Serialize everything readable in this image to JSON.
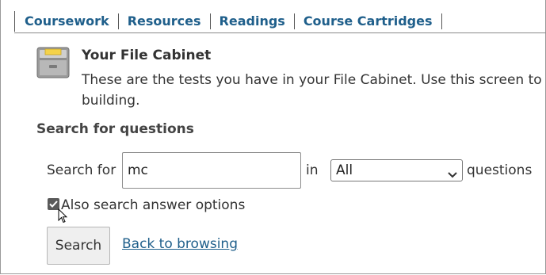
{
  "nav": {
    "items": [
      {
        "label": "Coursework"
      },
      {
        "label": "Resources"
      },
      {
        "label": "Readings"
      },
      {
        "label": "Course Cartridges"
      }
    ]
  },
  "header": {
    "title": "Your File Cabinet",
    "description": "These are the tests you have in your File Cabinet. Use this screen to",
    "description_cont": "building.",
    "icon": "file-cabinet-icon"
  },
  "search": {
    "heading": "Search for questions",
    "search_for_label": "Search for",
    "query_value": "mc",
    "in_label": "in",
    "scope_selected": "All",
    "questions_label": "questions",
    "also_answers_label": "Also search answer options",
    "also_answers_checked": true,
    "search_button": "Search",
    "back_link": "Back to browsing"
  },
  "colors": {
    "link": "#1f5f8b",
    "text": "#333333",
    "button_bg": "#efefef"
  }
}
